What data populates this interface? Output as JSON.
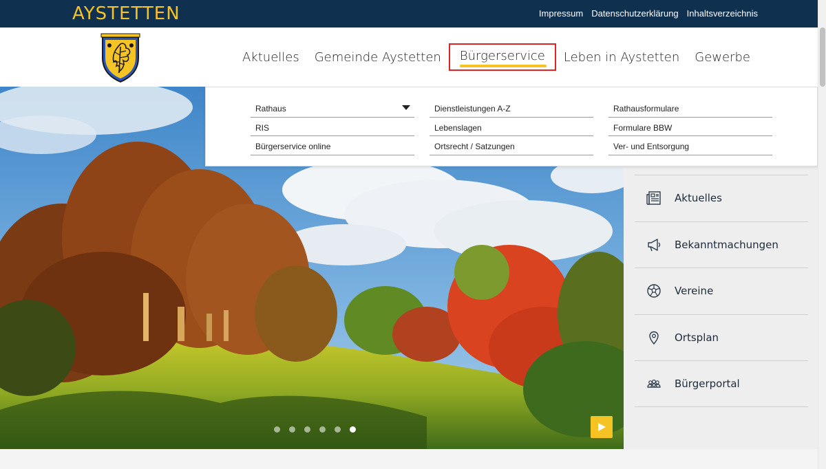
{
  "brand": {
    "name": "AYSTETTEN"
  },
  "toplinks": [
    {
      "label": "Impressum"
    },
    {
      "label": "Datenschutzerklärung"
    },
    {
      "label": "Inhaltsverzeichnis"
    }
  ],
  "mainnav": [
    {
      "label": "Aktuelles"
    },
    {
      "label": "Gemeinde Aystetten"
    },
    {
      "label": "Bürgerservice",
      "active": true
    },
    {
      "label": "Leben in Aystetten"
    },
    {
      "label": "Gewerbe"
    }
  ],
  "dropdown": {
    "columns": [
      [
        {
          "label": "Rathaus",
          "has_submenu": true
        },
        {
          "label": "RIS"
        },
        {
          "label": "Bürgerservice online"
        }
      ],
      [
        {
          "label": "Dienstleistungen A-Z"
        },
        {
          "label": "Lebenslagen"
        },
        {
          "label": "Ortsrecht / Satzungen"
        }
      ],
      [
        {
          "label": "Rathausformulare"
        },
        {
          "label": "Formulare BBW"
        },
        {
          "label": "Ver- und Entsorgung"
        }
      ]
    ]
  },
  "quicklinks": [
    {
      "label": "Aktuelles",
      "icon": "newspaper-icon"
    },
    {
      "label": "Bekanntmachungen",
      "icon": "megaphone-icon"
    },
    {
      "label": "Vereine",
      "icon": "soccer-ball-icon"
    },
    {
      "label": "Ortsplan",
      "icon": "map-pin-icon"
    },
    {
      "label": "Bürgerportal",
      "icon": "people-icon"
    }
  ],
  "slider": {
    "slide_count": 6,
    "active_slide": 6
  },
  "colors": {
    "topbar": "#10304f",
    "accent": "#f6c324",
    "highlight": "#e02424"
  }
}
